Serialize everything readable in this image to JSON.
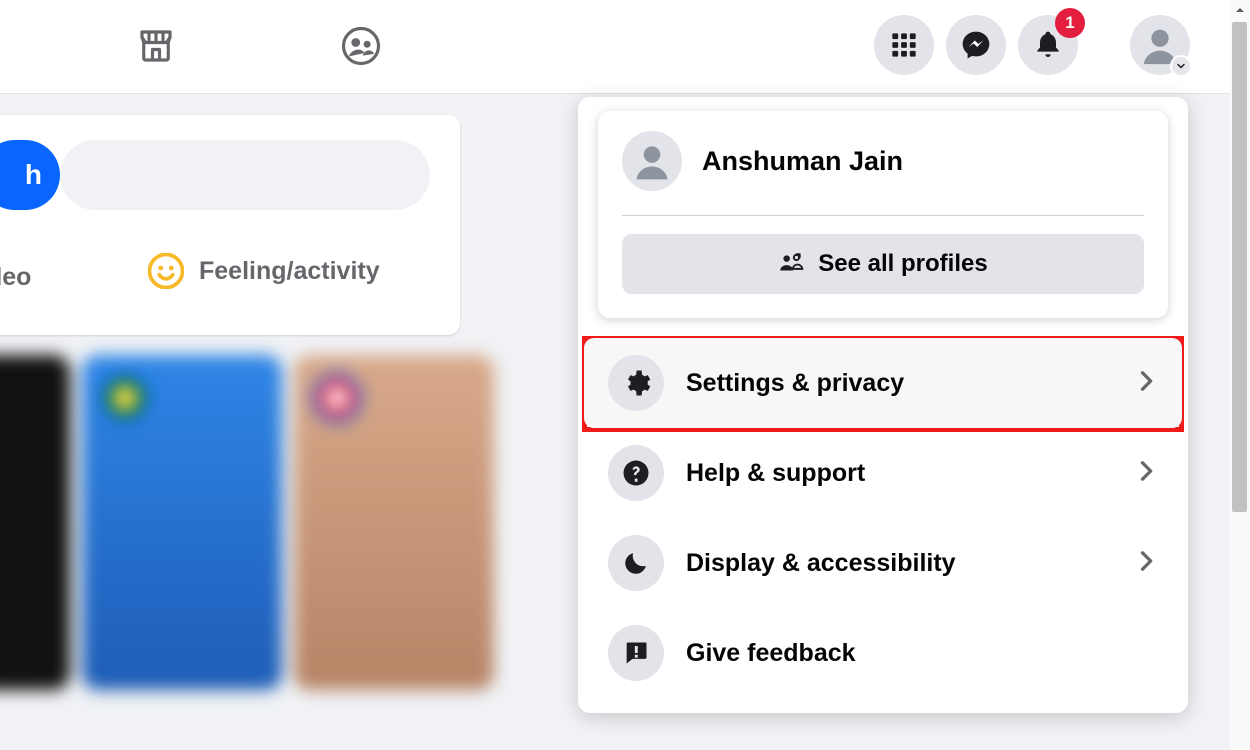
{
  "topbar": {
    "notification_count": "1"
  },
  "post": {
    "pill_suffix": "h",
    "video_label": "ideo",
    "feeling_label": "Feeling/activity"
  },
  "dropdown": {
    "profile_name": "Anshuman Jain",
    "see_all_label": "See all profiles",
    "items": [
      {
        "label": "Settings & privacy",
        "icon": "gear",
        "chevron": true,
        "highlighted": true
      },
      {
        "label": "Help & support",
        "icon": "help",
        "chevron": true
      },
      {
        "label": "Display & accessibility",
        "icon": "moon",
        "chevron": true
      },
      {
        "label": "Give feedback",
        "icon": "feedback",
        "chevron": false
      }
    ]
  }
}
